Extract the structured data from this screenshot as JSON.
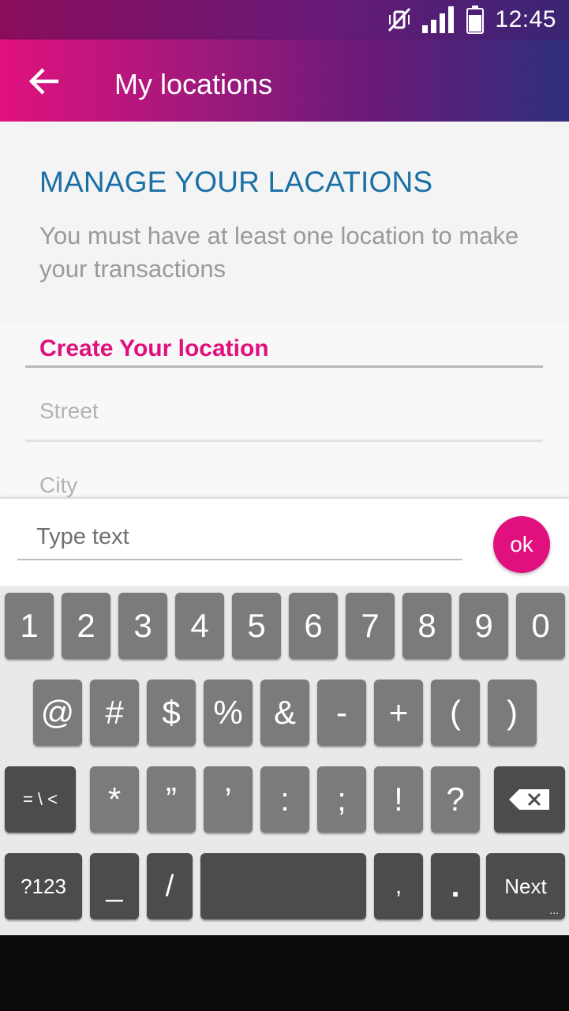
{
  "status_bar": {
    "time": "12:45",
    "icons": [
      "vibrate-off-icon",
      "signal-icon",
      "battery-icon"
    ]
  },
  "app_bar": {
    "back_icon": "arrow-left-icon",
    "title": "My locations"
  },
  "intro": {
    "title": "MANAGE YOUR LACATIONS",
    "description": "You must have at least one location to make your transactions"
  },
  "form": {
    "section_title": "Create Your location",
    "street_placeholder": "Street",
    "city_placeholder": "City"
  },
  "input_bar": {
    "placeholder": "Type text",
    "ok_label": "ok"
  },
  "keyboard": {
    "row1": [
      "1",
      "2",
      "3",
      "4",
      "5",
      "6",
      "7",
      "8",
      "9",
      "0"
    ],
    "row2": [
      "@",
      "#",
      "$",
      "%",
      "&",
      "-",
      "+",
      "(",
      ")"
    ],
    "row3_left": "= \\ <",
    "row3": [
      "*",
      "”",
      "’",
      ":",
      ";",
      "!",
      "?"
    ],
    "row3_right_icon": "backspace-icon",
    "row4_left": "?123",
    "row4_underscore": "_",
    "row4_slash": "/",
    "row4_comma": ",",
    "row4_period": ".",
    "row4_next": "Next",
    "row4_next_hint": "..."
  },
  "colors": {
    "accent_pink": "#e0117e",
    "title_blue": "#1a6fa5",
    "key_light": "#7b7b7b",
    "key_dark": "#4c4c4c"
  }
}
